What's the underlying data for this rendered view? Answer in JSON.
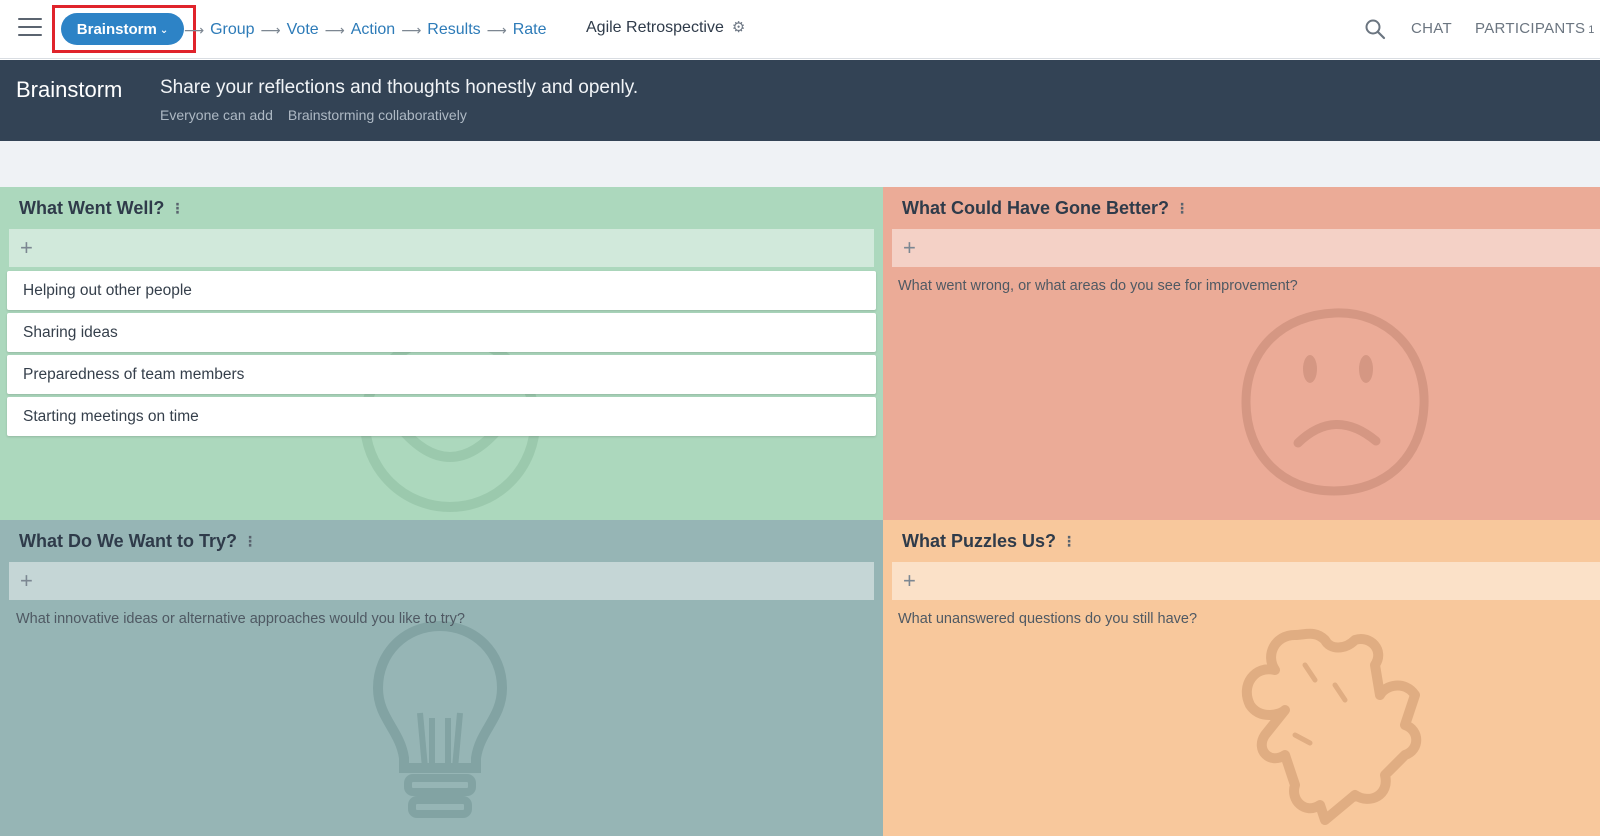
{
  "topnav": {
    "menu_icon": "hamburger-menu-icon",
    "current_phase": "Brainstorm",
    "phases": [
      "Group",
      "Vote",
      "Action",
      "Results",
      "Rate"
    ],
    "arrow": "⟶",
    "retro_title": "Agile Retrospective",
    "settings_icon": "gear-icon",
    "search_icon": "search-icon",
    "chat_label": "CHAT",
    "participants_label": "PARTICIPANTS",
    "participants_count": "1"
  },
  "banner": {
    "title": "Brainstorm",
    "description": "Share your reflections and thoughts honestly and openly.",
    "meta": [
      "Everyone can add",
      "Brainstorming collaboratively"
    ]
  },
  "columns": [
    {
      "title": "What Went Well?",
      "color": "#acd8bd",
      "prompt": "",
      "items": [
        "Helping out other people",
        "Sharing ideas",
        "Preparedness of team members",
        "Starting meetings on time"
      ],
      "watermark": "smiley-face-icon"
    },
    {
      "title": "What Could Have Gone Better?",
      "color": "#ebab97",
      "prompt": "What went wrong, or what areas do you see for improvement?",
      "items": [],
      "watermark": "sad-face-icon"
    },
    {
      "title": "What Do We Want to Try?",
      "color": "#96b5b5",
      "prompt": "What innovative ideas or alternative approaches would you like to try?",
      "items": [],
      "watermark": "lightbulb-icon"
    },
    {
      "title": "What Puzzles Us?",
      "color": "#f8c89c",
      "prompt": "What unanswered questions do you still have?",
      "items": [],
      "watermark": "puzzle-piece-icon"
    }
  ],
  "colors": {
    "accent": "#2d83c6",
    "banner_bg": "#334355",
    "highlight": "#e0232b"
  }
}
